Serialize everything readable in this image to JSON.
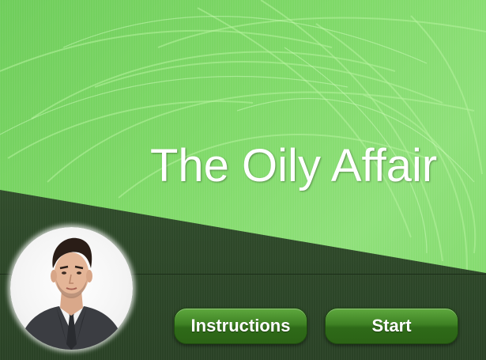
{
  "game": {
    "title": "The Oily Affair"
  },
  "buttons": {
    "instructions_label": "Instructions",
    "start_label": "Start"
  },
  "colors": {
    "background_green": "#7fd968",
    "dark_band": "#2f4a2a",
    "button_green": "#3f8224",
    "title_text": "#ffffff"
  },
  "avatar": {
    "icon": "businessman-portrait-icon"
  }
}
